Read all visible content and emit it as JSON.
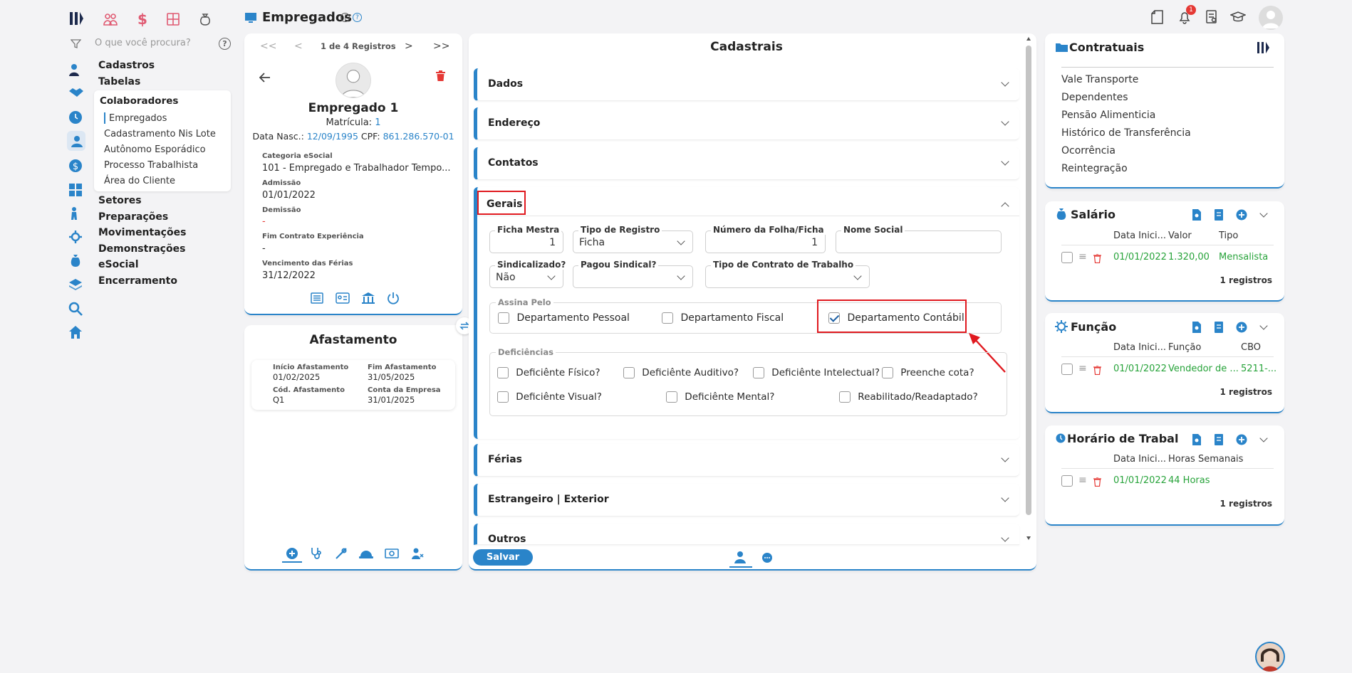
{
  "app": {
    "title": "Empregados"
  },
  "search": {
    "placeholder": "O que você procura?"
  },
  "nav": {
    "items": [
      "Cadastros",
      "Tabelas",
      "Colaboradores",
      "Setores",
      "Preparações",
      "Movimentações",
      "Demonstrações",
      "eSocial",
      "Encerramento"
    ],
    "sub_items": [
      "Empregados",
      "Cadastramento Nis Lote",
      "Autônomo Esporádico",
      "Processo Trabalhista",
      "Área do Cliente"
    ]
  },
  "notifications": {
    "count": "1"
  },
  "employee": {
    "pagination": "1 de 4 Registros",
    "name": "Empregado 1",
    "matricula_label": "Matrícula:",
    "matricula": "1",
    "birth_label": "Data Nasc.:",
    "birth": "12/09/1995",
    "cpf_label": "CPF:",
    "cpf": "861.286.570-01",
    "fields": [
      {
        "label": "Categoria eSocial",
        "value": "101 - Empregado e Trabalhador Tempo..."
      },
      {
        "label": "Admissão",
        "value": "01/01/2022"
      },
      {
        "label": "Demissão",
        "value": "-"
      },
      {
        "label": "Fim Contrato Experiência",
        "value": "-"
      },
      {
        "label": "Vencimento das Férias",
        "value": "31/12/2022"
      }
    ]
  },
  "afastamento": {
    "title": "Afastamento",
    "inicio_label": "Início Afastamento",
    "inicio": "01/02/2025",
    "fim_label": "Fim Afastamento",
    "fim": "31/05/2025",
    "cod_label": "Cód. Afastamento",
    "cod": "Q1",
    "conta_label": "Conta da Empresa",
    "conta": "31/01/2025"
  },
  "cadastrais": {
    "title": "Cadastrais",
    "sections": [
      "Dados",
      "Endereço",
      "Contatos",
      "Gerais",
      "Férias",
      "Estrangeiro | Exterior",
      "Outros"
    ],
    "gerais": {
      "ficha_mestra_label": "Ficha Mestra",
      "ficha_mestra": "1",
      "tipo_registro_label": "Tipo de Registro",
      "tipo_registro": "Ficha",
      "numero_folha_label": "Número da Folha/Ficha",
      "numero_folha": "1",
      "nome_social_label": "Nome Social",
      "nome_social": "",
      "sindicalizado_label": "Sindicalizado?",
      "sindicalizado": "Não",
      "pagou_sindical_label": "Pagou Sindical?",
      "pagou_sindical": "",
      "tipo_contrato_label": "Tipo de Contrato de Trabalho",
      "tipo_contrato": "",
      "assina_pelo_label": "Assina Pelo",
      "assina": [
        "Departamento Pessoal",
        "Departamento Fiscal",
        "Departamento Contábil"
      ],
      "deficiencias_label": "Deficiências",
      "deficiencias": [
        "Deficiênte Físico?",
        "Deficiênte Auditivo?",
        "Deficiênte Intelectual?",
        "Preenche cota?",
        "Deficiênte Visual?",
        "Deficiênte Mental?",
        "Reabilitado/Readaptado?"
      ]
    },
    "save_label": "Salvar"
  },
  "contratuais": {
    "title": "Contratuais",
    "links": [
      "Vale Transporte",
      "Dependentes",
      "Pensão Alimenticia",
      "Histórico de Transferência",
      "Ocorrência",
      "Reintegração"
    ]
  },
  "salario": {
    "title": "Salário",
    "headers": [
      "Data Inici...",
      "Valor",
      "Tipo"
    ],
    "row": [
      "01/01/2022",
      "1.320,00",
      "Mensalista"
    ],
    "count": "1 registros"
  },
  "funcao": {
    "title": "Função",
    "headers": [
      "Data Inici...",
      "Função",
      "CBO"
    ],
    "row": [
      "01/01/2022",
      "Vendedor de ...",
      "5211-..."
    ],
    "count": "1 registros"
  },
  "horario": {
    "title": "Horário de Trabalho",
    "headers": [
      "Data Inici...",
      "Horas Semanais"
    ],
    "row": [
      "01/01/2022",
      "44 Horas"
    ],
    "count": "1 registros"
  },
  "colors": {
    "accent": "#2a84c9",
    "green": "#27a33a",
    "red": "#e53935",
    "highlight": "#e0191f"
  }
}
